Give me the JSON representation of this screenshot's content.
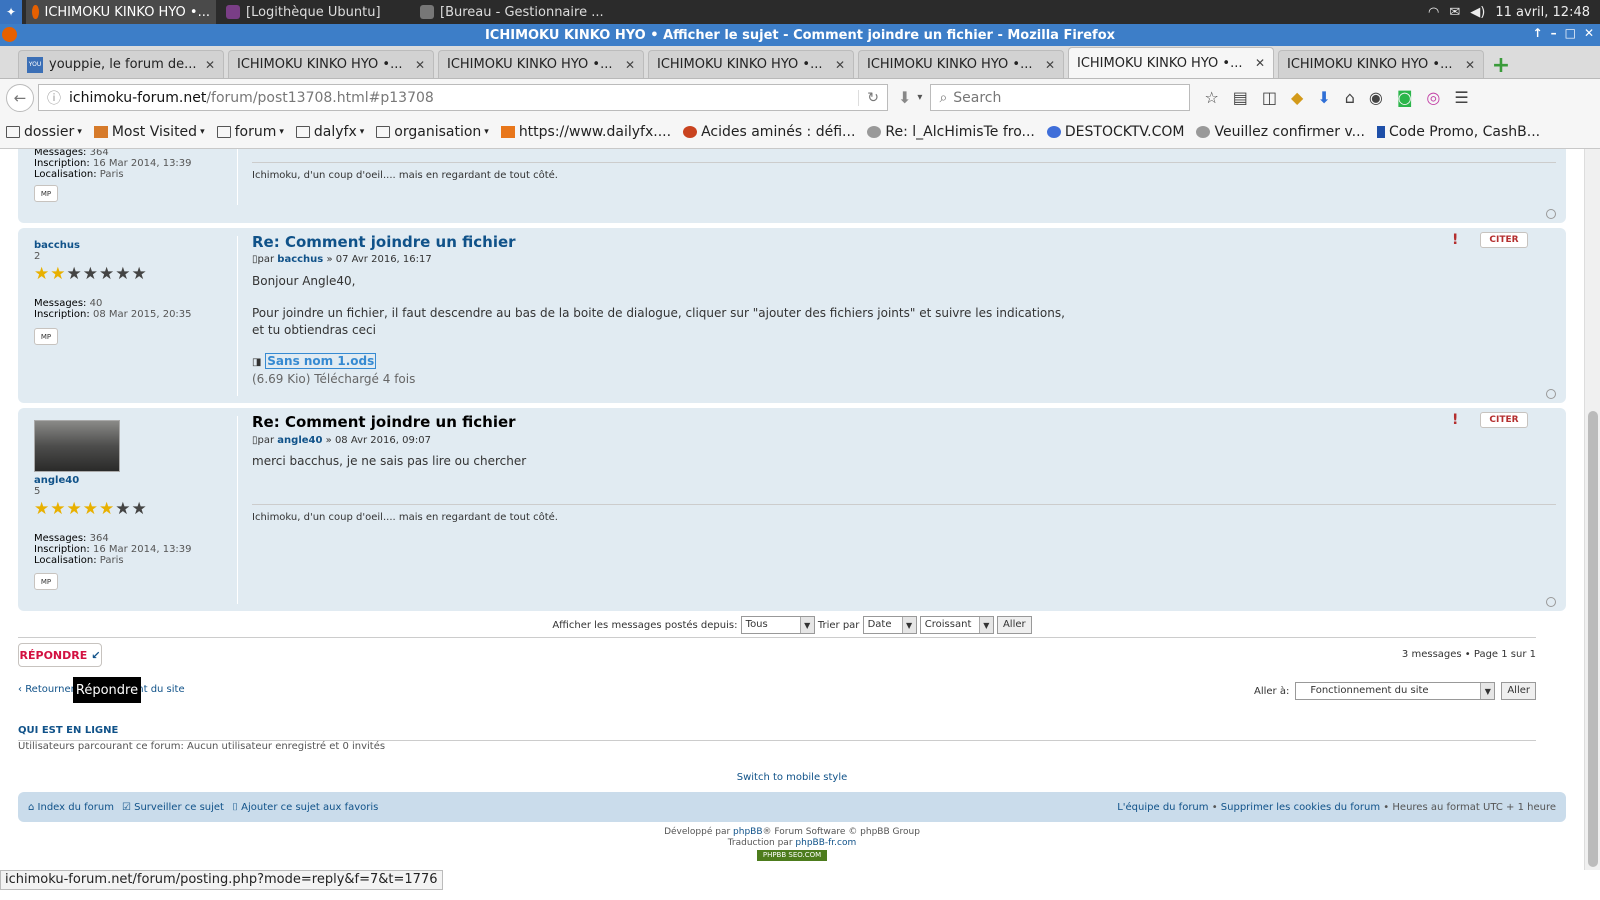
{
  "taskbar": {
    "tasks": [
      {
        "label": "ICHIMOKU KINKO HYO •...",
        "active": true
      },
      {
        "label": "[Logithèque Ubuntu]",
        "active": false
      },
      {
        "label": "[Bureau - Gestionnaire ...",
        "active": false
      }
    ],
    "clock": "11 avril, 12:48"
  },
  "window": {
    "title": "ICHIMOKU KINKO HYO • Afficher le sujet - Comment joindre un fichier - Mozilla Firefox"
  },
  "tabs": [
    {
      "label": "youppie, le forum de...",
      "active": false,
      "fav": "YOU PPIE"
    },
    {
      "label": "ICHIMOKU KINKO HYO •...",
      "active": false
    },
    {
      "label": "ICHIMOKU KINKO HYO •...",
      "active": false
    },
    {
      "label": "ICHIMOKU KINKO HYO •...",
      "active": false
    },
    {
      "label": "ICHIMOKU KINKO HYO •...",
      "active": false
    },
    {
      "label": "ICHIMOKU KINKO HYO •...",
      "active": true
    },
    {
      "label": "ICHIMOKU KINKO HYO •...",
      "active": false
    }
  ],
  "navbar": {
    "url_domain": "ichimoku-forum.net",
    "url_path": "/forum/post13708.html#p13708",
    "search_placeholder": "Search"
  },
  "bookmarks": [
    {
      "label": "dossier",
      "dropdown": true,
      "icon": "folder-icon"
    },
    {
      "label": "Most Visited",
      "dropdown": true,
      "icon": "most-visited-icon"
    },
    {
      "label": "forum",
      "dropdown": true,
      "icon": "folder-icon"
    },
    {
      "label": "dalyfx",
      "dropdown": true,
      "icon": "folder-icon"
    },
    {
      "label": "organisation",
      "dropdown": true,
      "icon": "folder-icon"
    },
    {
      "label": "https://www.dailyfx....",
      "dropdown": false,
      "icon": "dailyfx-icon"
    },
    {
      "label": "Acides aminés : défi...",
      "dropdown": false,
      "icon": "site-icon"
    },
    {
      "label": "Re: l_AlcHimisTe fro...",
      "dropdown": false,
      "icon": "site-icon"
    },
    {
      "label": "DESTOCKTV.COM",
      "dropdown": false,
      "icon": "site-icon"
    },
    {
      "label": "Veuillez confirmer v...",
      "dropdown": false,
      "icon": "site-icon"
    },
    {
      "label": "Code Promo, CashB...",
      "dropdown": false,
      "icon": "site-icon"
    }
  ],
  "posts": {
    "p1": {
      "messages_label": "Messages:",
      "messages": "364",
      "inscription_label": "Inscription:",
      "inscription": "16 Mar 2014, 13:39",
      "localisation_label": "Localisation:",
      "localisation": "Paris",
      "signature": "Ichimoku, d'un coup d'oeil.... mais en regardant de tout côté."
    },
    "p2": {
      "author": "bacchus",
      "rank": "2",
      "messages_label": "Messages:",
      "messages": "40",
      "inscription_label": "Inscription:",
      "inscription": "08 Mar 2015, 20:35",
      "title": "Re: Comment joindre un fichier",
      "meta_prefix": "par",
      "meta_author": "bacchus",
      "meta_date": "» 07 Avr 2016, 16:17",
      "body_1": "Bonjour Angle40,",
      "body_2": "Pour joindre un fichier, il faut descendre au bas de la boite de dialogue, cliquer sur \"ajouter des fichiers joints\" et suivre les indications,",
      "body_3": "et tu obtiendras ceci",
      "attachment_name": "Sans nom 1.ods",
      "attachment_info": "(6.69 Kio) Téléchargé 4 fois",
      "stars_on": 2,
      "stars_total": 7
    },
    "p3": {
      "author": "angle40",
      "rank": "5",
      "messages_label": "Messages:",
      "messages": "364",
      "inscription_label": "Inscription:",
      "inscription": "16 Mar 2014, 13:39",
      "localisation_label": "Localisation:",
      "localisation": "Paris",
      "title": "Re: Comment joindre un fichier",
      "meta_prefix": "par",
      "meta_author": "angle40",
      "meta_date": "» 08 Avr 2016, 09:07",
      "body_1": "merci bacchus, je ne sais pas lire ou chercher",
      "signature": "Ichimoku, d'un coup d'oeil.... mais en regardant de tout côté.",
      "stars_on": 5,
      "stars_total": 7
    },
    "mp_label": "MP",
    "quote_label": "CITER"
  },
  "sortbar": {
    "label_display": "Afficher les messages postés depuis:",
    "display_value": "Tous",
    "label_sort": "Trier par",
    "sort_value": "Date",
    "order_value": "Croissant",
    "go_label": "Aller"
  },
  "actions": {
    "reply_label": "RÉPONDRE",
    "tooltip": "Répondre",
    "pageinfo": "3 messages • Page 1 sur 1",
    "back_prefix": "Retourner",
    "back_suffix": "nent du site",
    "jump_label": "Aller à:",
    "jump_value": "Fonctionnement du site",
    "jump_go": "Aller"
  },
  "online": {
    "heading": "QUI EST EN LIGNE",
    "text": "Utilisateurs parcourant ce forum: Aucun utilisateur enregistré et 0 invités"
  },
  "mobile_link": "Switch to mobile style",
  "footer": {
    "index": "Index du forum",
    "watch": "Surveiller ce sujet",
    "bookmark": "Ajouter ce sujet aux favoris",
    "team": "L'équipe du forum",
    "sep1": "•",
    "cookies": "Supprimer les cookies du forum",
    "sep2": "•",
    "timezone": "Heures au format UTC + 1 heure"
  },
  "credits": {
    "line1_prefix": "Développé par",
    "line1_link": "phpBB",
    "line1_suffix": "® Forum Software © phpBB Group",
    "line2_prefix": "Traduction par",
    "line2_link": "phpBB-fr.com",
    "badge": "PHPBB SEO.COM"
  },
  "statusbar": "ichimoku-forum.net/forum/posting.php?mode=reply&f=7&t=1776"
}
